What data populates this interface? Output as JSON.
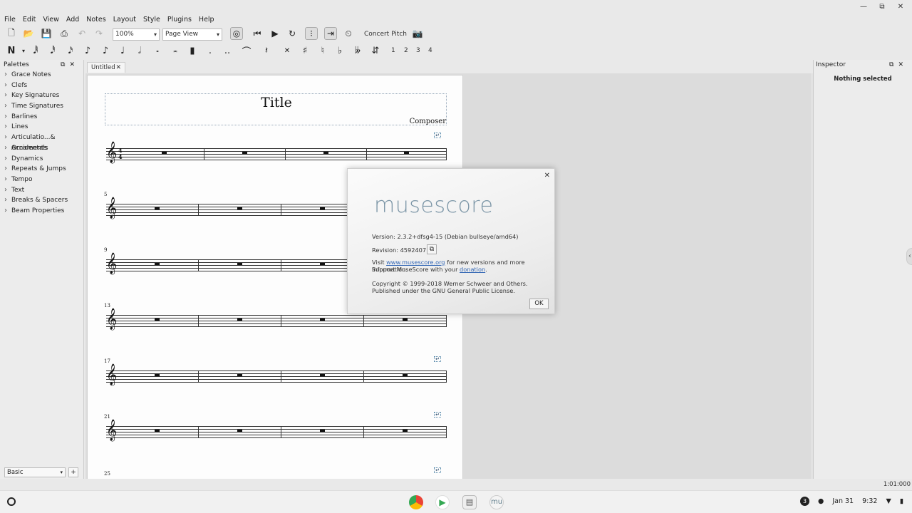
{
  "window_controls": {
    "minimize": "—",
    "maximize": "⧉",
    "close": "✕"
  },
  "menu": [
    "File",
    "Edit",
    "View",
    "Add",
    "Notes",
    "Layout",
    "Style",
    "Plugins",
    "Help"
  ],
  "toolbar": {
    "zoom_value": "100%",
    "view_mode": "Page View",
    "concert_pitch": "Concert Pitch",
    "voices": [
      "1",
      "2",
      "3",
      "4"
    ]
  },
  "palettes": {
    "title": "Palettes",
    "items": [
      "Grace Notes",
      "Clefs",
      "Key Signatures",
      "Time Signatures",
      "Barlines",
      "Lines",
      "Articulatio...& Ornaments",
      "Accidentals",
      "Dynamics",
      "Repeats & Jumps",
      "Tempo",
      "Text",
      "Breaks & Spacers",
      "Beam Properties"
    ],
    "workspace": "Basic",
    "add_label": "+"
  },
  "score_tab": {
    "label": "Untitled",
    "close": "✕"
  },
  "score": {
    "title": "Title",
    "composer": "Composer",
    "time_sig_top": "4",
    "time_sig_bottom": "4",
    "measure_numbers": [
      "5",
      "9",
      "13",
      "17",
      "21",
      "25"
    ],
    "break_mark": "↵"
  },
  "inspector": {
    "title": "Inspector",
    "empty_text": "Nothing selected"
  },
  "status": {
    "time_position": "1:01:000"
  },
  "about_dialog": {
    "logo_text": "musescore",
    "version": "Version: 2.3.2+dfsg4-15 (Debian bullseye/amd64)",
    "revision": "Revision: 4592407",
    "visit_prefix": "Visit ",
    "visit_link": "www.musescore.org",
    "visit_suffix": " for new versions and more information.",
    "support_prefix": "Support MuseScore with your ",
    "support_link": "donation",
    "support_suffix": ".",
    "copyright": "Copyright © 1999-2018 Werner Schweer and Others.",
    "license": "Published under the GNU General Public License.",
    "ok_label": "OK",
    "close": "✕"
  },
  "shelf": {
    "badge_count": "3",
    "date": "Jan 31",
    "time": "9:32",
    "app_colors": {
      "chrome": "#ea4335",
      "play": "#34a853",
      "files": "#8d6e63",
      "musescore": "#607d8b"
    }
  }
}
